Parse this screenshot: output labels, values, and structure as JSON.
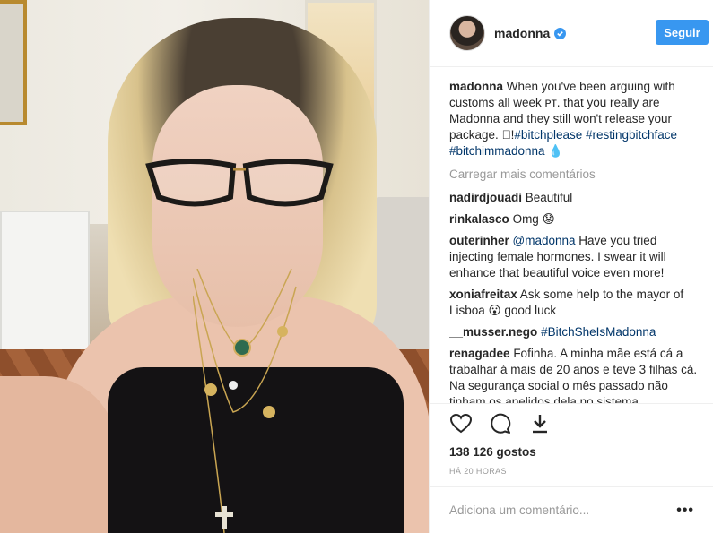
{
  "post": {
    "username": "madonna",
    "follow_label": "Seguir",
    "caption": {
      "user": "madonna",
      "text": "When you've been arguing with customs all week ᴘᴛ. that you really are Madonna and they still won't release your package. ⃞!",
      "tags": [
        "#bitchplease",
        "#restingbitchface",
        "#bitchimmadonna"
      ],
      "trailing": " 💧"
    },
    "load_more": "Carregar mais comentários",
    "comments": [
      {
        "user": "nadirdjouadi",
        "text": "Beautiful"
      },
      {
        "user": "rinkalasco",
        "text": "Omg 😟"
      },
      {
        "user": "outerinher",
        "mention": "@madonna",
        "text": " Have you tried injecting female hormones. I swear it will enhance that beautiful voice even more!"
      },
      {
        "user": "xoniafreitax",
        "text": "Ask some help to the mayor of Lisboa 😮 good luck"
      },
      {
        "user": "__musser.nego",
        "mention": "#BitchSheIsMadonna",
        "text": ""
      },
      {
        "user": "renagadee",
        "text": "Fofinha. A minha mãe está cá a trabalhar á mais de 20 anos e teve 3 filhas cá. Na segurança social o mês passado não tinham os apelidos dela no sistema"
      }
    ],
    "likes": "138 126 gostos",
    "timestamp": "HÁ 20 HORAS",
    "comment_placeholder": "Adiciona um comentário...",
    "more_options": "•••",
    "icons": {
      "like": "heart-icon",
      "comment": "comment-bubble-icon",
      "save": "download-icon",
      "verified": "verified-badge-icon"
    },
    "colors": {
      "accent": "#3897f0",
      "link": "#003569",
      "muted": "#999999",
      "text": "#262626"
    }
  }
}
